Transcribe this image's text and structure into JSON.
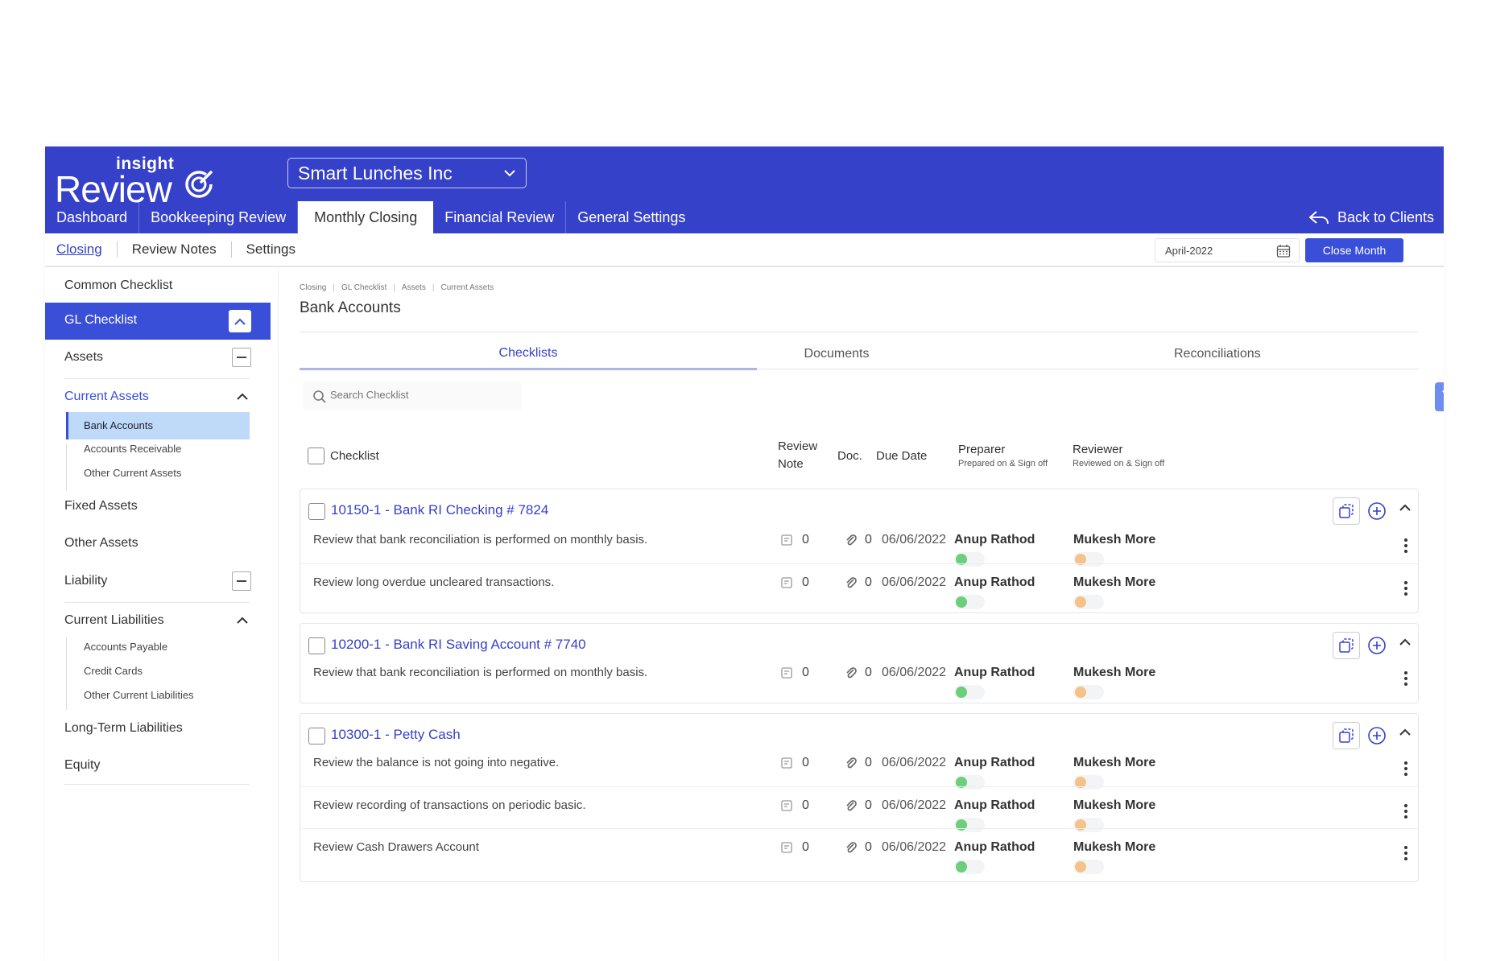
{
  "brand": {
    "small": "insight",
    "big": "Review"
  },
  "company": "Smart Lunches Inc",
  "nav": [
    "Dashboard",
    "Bookkeeping Review",
    "Monthly Closing",
    "Financial Review",
    "General Settings"
  ],
  "back_label": "Back to Clients",
  "subnav": [
    "Closing",
    "Review Notes",
    "Settings"
  ],
  "date": "April-2022",
  "close_month": "Close Month",
  "sidebar": {
    "common": "Common Checklist",
    "gl": "GL Checklist",
    "assets": "Assets",
    "current_assets": "Current Assets",
    "ca_items": [
      "Bank Accounts",
      "Accounts Receivable",
      "Other Current Assets"
    ],
    "fixed_assets": "Fixed Assets",
    "other_assets": "Other Assets",
    "liability": "Liability",
    "current_liabilities": "Current Liabilities",
    "cl_items": [
      "Accounts Payable",
      "Credit Cards",
      "Other Current Liabilities"
    ],
    "long_term": "Long-Term Liabilities",
    "equity": "Equity"
  },
  "breadcrumb": [
    "Closing",
    "GL Checklist",
    "Assets",
    "Current Assets"
  ],
  "page_title": "Bank Accounts",
  "tabs": [
    "Checklists",
    "Documents",
    "Reconciliations"
  ],
  "search_placeholder": "Search Checklist",
  "table": {
    "checklist": "Checklist",
    "review": "Review",
    "note": "Note",
    "doc": "Doc.",
    "due": "Due Date",
    "preparer": "Preparer",
    "preparer_sub": "Prepared on & Sign off",
    "reviewer": "Reviewer",
    "reviewer_sub": "Reviewed on & Sign off"
  },
  "groups": [
    {
      "title": "10150-1 - Bank RI Checking # 7824",
      "rows": [
        {
          "desc": "Review that bank reconciliation is performed on monthly basis.",
          "notes": "0",
          "docs": "0",
          "due": "06/06/2022",
          "preparer": "Anup Rathod",
          "reviewer": "Mukesh More"
        },
        {
          "desc": "Review long overdue uncleared transactions.",
          "notes": "0",
          "docs": "0",
          "due": "06/06/2022",
          "preparer": "Anup Rathod",
          "reviewer": "Mukesh More"
        }
      ]
    },
    {
      "title": "10200-1 - Bank RI Saving Account # 7740",
      "rows": [
        {
          "desc": "Review that bank reconciliation is performed on monthly basis.",
          "notes": "0",
          "docs": "0",
          "due": "06/06/2022",
          "preparer": "Anup Rathod",
          "reviewer": "Mukesh More"
        }
      ]
    },
    {
      "title": "10300-1 - Petty Cash",
      "rows": [
        {
          "desc": "Review the balance is not going into negative.",
          "notes": "0",
          "docs": "0",
          "due": "06/06/2022",
          "preparer": "Anup Rathod",
          "reviewer": "Mukesh More"
        },
        {
          "desc": "Review recording of transactions on periodic basic.",
          "notes": "0",
          "docs": "0",
          "due": "06/06/2022",
          "preparer": "Anup Rathod",
          "reviewer": "Mukesh More"
        },
        {
          "desc": "Review Cash Drawers Account",
          "notes": "0",
          "docs": "0",
          "due": "06/06/2022",
          "preparer": "Anup Rathod",
          "reviewer": "Mukesh More"
        }
      ]
    }
  ],
  "colors": {
    "header": "#3641c9",
    "accent": "#3a4fd8",
    "selected": "#bedaf8",
    "preparer_dot": "#6ccf7c",
    "reviewer_dot": "#f5c28a"
  }
}
